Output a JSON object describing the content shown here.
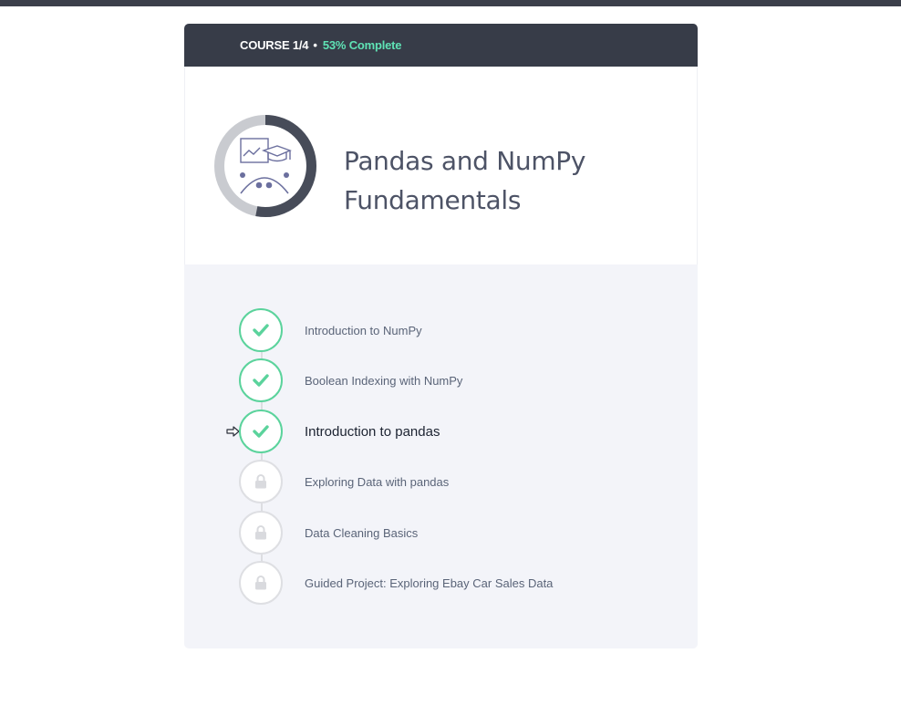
{
  "header": {
    "course_label": "COURSE 1/4",
    "separator": "•",
    "progress_text": "53% Complete",
    "progress_fraction": 0.53
  },
  "course": {
    "title": "Pandas and NumPy Fundamentals",
    "icon": "data-science-graduation-icon"
  },
  "lessons": [
    {
      "label": "Introduction to NumPy",
      "status": "completed",
      "icon": "check-icon"
    },
    {
      "label": "Boolean Indexing with NumPy",
      "status": "completed",
      "icon": "check-icon"
    },
    {
      "label": "Introduction to pandas",
      "status": "completed",
      "icon": "check-icon",
      "current": true
    },
    {
      "label": "Exploring Data with pandas",
      "status": "locked",
      "icon": "lock-icon"
    },
    {
      "label": "Data Cleaning Basics",
      "status": "locked",
      "icon": "lock-icon"
    },
    {
      "label": "Guided Project: Exploring Ebay Car Sales Data",
      "status": "locked",
      "icon": "lock-icon"
    }
  ],
  "colors": {
    "header_bg": "#373c48",
    "progress_accent": "#5fe3b5",
    "completed_green": "#5bd39c",
    "locked_gray": "#dedfe3",
    "ring_fill": "#474c59",
    "ring_track": "#c9cbd0"
  }
}
